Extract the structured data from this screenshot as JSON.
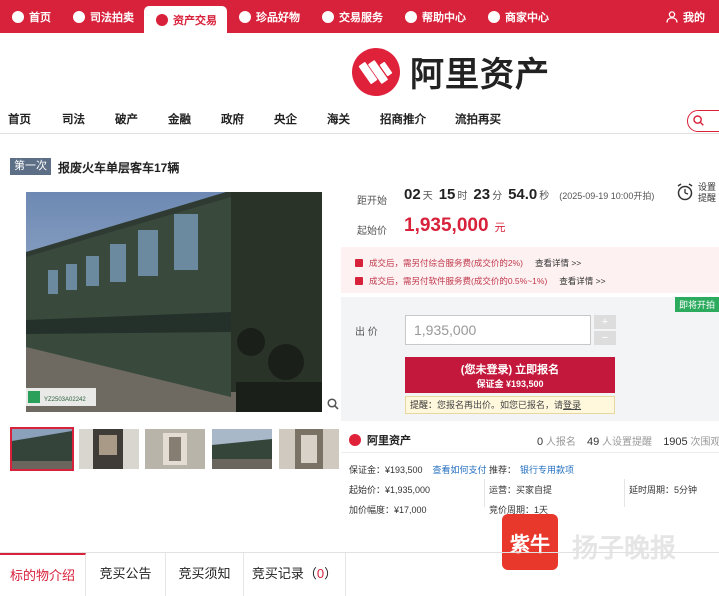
{
  "topnav": {
    "items": [
      {
        "label": "首页",
        "icon": "home-icon"
      },
      {
        "label": "司法拍卖",
        "icon": "gavel-icon"
      },
      {
        "label": "资产交易",
        "icon": "asset-icon"
      },
      {
        "label": "珍品好物",
        "icon": "gem-icon"
      },
      {
        "label": "交易服务",
        "icon": "heart-icon"
      },
      {
        "label": "帮助中心",
        "icon": "help-icon"
      },
      {
        "label": "商家中心",
        "icon": "shop-icon"
      }
    ],
    "active_index": 2,
    "mine": "我的"
  },
  "logo": {
    "text": "阿里资产"
  },
  "catnav": {
    "items": [
      "首页",
      "司法",
      "破产",
      "金融",
      "政府",
      "央企",
      "海关",
      "招商推介",
      "流拍再买"
    ],
    "search_placeholder": "搜索"
  },
  "listing": {
    "tag": "第一次",
    "title": "报废火车单层客车17辆"
  },
  "countdown": {
    "label": "距开始",
    "days": "02",
    "days_unit": "天",
    "hours": "15",
    "hours_unit": "时",
    "minutes": "23",
    "minutes_unit": "分",
    "seconds": "54.0",
    "seconds_unit": "秒",
    "start": "(2025-09-19 10:00开拍)"
  },
  "reminder": {
    "label": "设置提醒"
  },
  "start_price": {
    "label": "起始价",
    "value": "1,935,000",
    "unit": "元"
  },
  "notes": [
    {
      "text": "成交后，需另付综合服务费(成交价的2%)",
      "link": "查看详情 >>"
    },
    {
      "text": "成交后，需另付软件服务费(成交价的0.5%~1%)",
      "link": "查看详情 >>"
    }
  ],
  "bid": {
    "status_badge": "即将开拍",
    "label": "出  价",
    "input_value": "1,935,000",
    "plus": "+",
    "minus": "−",
    "signup_line1": "(您未登录) 立即报名",
    "signup_line2": "保证金 ¥193,500",
    "tip_prefix": "提醒：",
    "tip_text": "您报名再出价。如您已报名，请",
    "tip_link": "登录"
  },
  "seller": {
    "name": "阿里资产"
  },
  "stats": [
    {
      "count": "0",
      "label": "人报名"
    },
    {
      "count": "49",
      "label": "人设置提醒"
    },
    {
      "count": "1905",
      "label": "次围观"
    }
  ],
  "details": {
    "deposit": "保证金：¥193,500",
    "deposit_link": "查看如何支付",
    "recommend_label": "推荐：",
    "recommend_link": "银行专用款项",
    "start_price": "起始价：¥1,935,000",
    "bid_increment": "加价幅度：¥17,000",
    "auction_rule": "运营：买家自提",
    "bid_period": "竞价周期：1天",
    "delay_period": "延时周期：5分钟"
  },
  "tabs": [
    {
      "label": "标的物介绍"
    },
    {
      "label": "竞买公告"
    },
    {
      "label": "竞买须知"
    },
    {
      "label": "竞买记录",
      "count": "0"
    }
  ],
  "watermark": {
    "logo": "紫牛",
    "text": "扬子晚报"
  },
  "photo_label": "YZ2503A02242",
  "colors": {
    "brand_red": "#d8213a",
    "link_blue": "#2470c0",
    "soon_green": "#2cab5f"
  }
}
